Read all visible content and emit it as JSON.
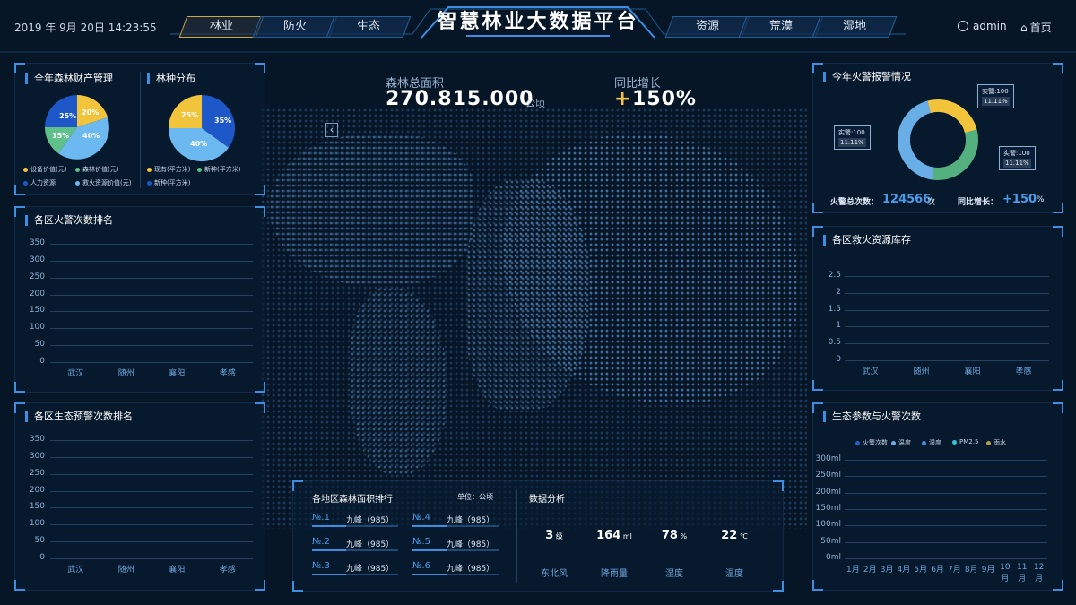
{
  "header": {
    "datetime": "2019 年 9月 20日 14:23:55",
    "title": "智慧林业大数据平台",
    "tabs_left": [
      "林业",
      "防火",
      "生态"
    ],
    "tabs_right": [
      "资源",
      "荒漠",
      "湿地"
    ],
    "user": "admin",
    "home": "首页"
  },
  "center": {
    "area_label": "森林总面积",
    "area_value": "270.815.000",
    "area_unit": "公顷",
    "growth_label": "同比增长",
    "growth_plus": "+",
    "growth_value": "150%"
  },
  "panel_assets": {
    "title1": "全年森林财产管理",
    "title2": "林种分布",
    "pie1_labels": [
      "20%",
      "40%",
      "15%",
      "25%"
    ],
    "pie1_legend": [
      "设备价值(元)",
      "森林价值(元)",
      "人力资源",
      "救火资源价值(元)"
    ],
    "pie2_labels": [
      "35%",
      "40%",
      "25%"
    ],
    "pie2_legend": [
      "现有(平方米)",
      "新种(平方米)",
      "新种(平方米)"
    ]
  },
  "panel_fire_rank": {
    "title": "各区火警次数排名",
    "y_ticks": [
      "350",
      "300",
      "250",
      "200",
      "150",
      "100",
      "50",
      "0"
    ],
    "categories": [
      "武汉",
      "随州",
      "襄阳",
      "孝感"
    ]
  },
  "panel_eco_rank": {
    "title": "各区生态预警次数排名",
    "y_ticks": [
      "350",
      "300",
      "250",
      "200",
      "150",
      "100",
      "50",
      "0"
    ],
    "categories": [
      "武汉",
      "随州",
      "襄阳",
      "孝感"
    ]
  },
  "panel_alarm": {
    "title": "今年火警报警情况",
    "callouts": [
      {
        "top": "实警:100",
        "sub": "11.11%"
      },
      {
        "top": "实警:100",
        "sub": "11.11%"
      },
      {
        "top": "实警:100",
        "sub": "11.11%"
      }
    ],
    "total_label": "火警总次数：",
    "total_value": "124566",
    "total_unit": "次",
    "growth_label": "同比增长：",
    "growth_value": "+150",
    "growth_unit": "%"
  },
  "panel_rescue": {
    "title": "各区救火资源库存",
    "y_ticks": [
      "2.5",
      "2",
      "1.5",
      "1",
      "0.5",
      "0"
    ],
    "categories": [
      "武汉",
      "随州",
      "襄阳",
      "孝感"
    ]
  },
  "panel_eco_params": {
    "title": "生态参数与火警次数",
    "legend": [
      "火警次数",
      "温度",
      "湿度",
      "PM2.5",
      "雨水"
    ],
    "legend_colors": [
      "#2f5bc5",
      "#6aaee8",
      "#3d8ee0",
      "#2fc6d6",
      "#b99a4a"
    ],
    "y_ticks": [
      "300ml",
      "250ml",
      "200ml",
      "150ml",
      "100ml",
      "50ml",
      "0ml"
    ],
    "months": [
      "1月",
      "2月",
      "3月",
      "4月",
      "5月",
      "6月",
      "7月",
      "8月",
      "9月",
      "10月",
      "11月",
      "12月"
    ]
  },
  "panel_area_rank": {
    "title": "各地区森林面积排行",
    "unit": "单位：公顷",
    "items": [
      {
        "no": "№.1",
        "name": "九峰（985）"
      },
      {
        "no": "№.2",
        "name": "九峰（985）"
      },
      {
        "no": "№.3",
        "name": "九峰（985）"
      },
      {
        "no": "№.4",
        "name": "九峰（985）"
      },
      {
        "no": "№.5",
        "name": "九峰（985）"
      },
      {
        "no": "№.6",
        "name": "九峰（985）"
      }
    ]
  },
  "panel_analysis": {
    "title": "数据分析",
    "stats": [
      {
        "value": "3",
        "unit": "级",
        "label": "东北风"
      },
      {
        "value": "164",
        "unit": "ml",
        "label": "降雨量"
      },
      {
        "value": "78",
        "unit": "%",
        "label": "湿度"
      },
      {
        "value": "22",
        "unit": "℃",
        "label": "温度"
      }
    ]
  }
}
